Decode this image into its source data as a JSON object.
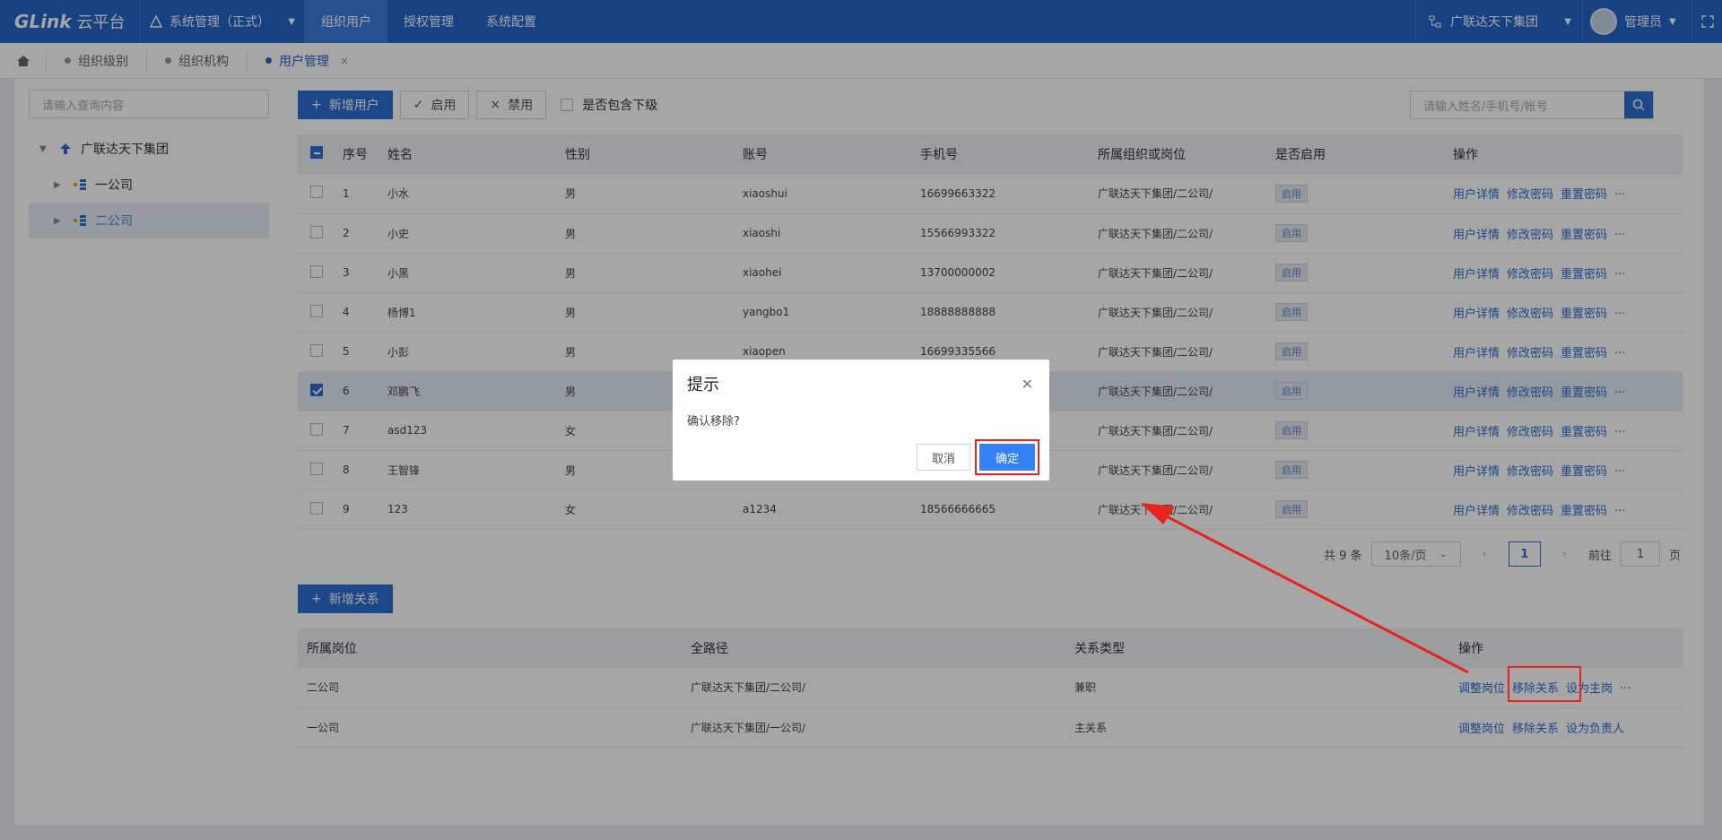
{
  "header": {
    "logo": "GLink",
    "logo_sub": "云平台",
    "system": "系统管理（正式）",
    "nav": [
      "组织用户",
      "授权管理",
      "系统配置"
    ],
    "org": "广联达天下集团",
    "user": "管理员"
  },
  "tabs": [
    "组织级别",
    "组织机构",
    "用户管理"
  ],
  "left": {
    "search_placeholder": "请输入查询内容",
    "tree": [
      "广联达天下集团",
      "一公司",
      "二公司"
    ]
  },
  "toolbar": {
    "add_user": "新增用户",
    "enable": "启用",
    "disable": "禁用",
    "include_sub": "是否包含下级",
    "search_placeholder": "请输入姓名/手机号/帐号"
  },
  "users": {
    "columns": [
      "序号",
      "姓名",
      "性别",
      "账号",
      "手机号",
      "所属组织或岗位",
      "是否启用",
      "操作"
    ],
    "rows": [
      {
        "no": "1",
        "name": "小水",
        "gender": "男",
        "account": "xiaoshui",
        "phone": "16699663322",
        "org": "广联达天下集团/二公司/",
        "status": "启用"
      },
      {
        "no": "2",
        "name": "小史",
        "gender": "男",
        "account": "xiaoshi",
        "phone": "15566993322",
        "org": "广联达天下集团/二公司/",
        "status": "启用"
      },
      {
        "no": "3",
        "name": "小黑",
        "gender": "男",
        "account": "xiaohei",
        "phone": "13700000002",
        "org": "广联达天下集团/二公司/",
        "status": "启用"
      },
      {
        "no": "4",
        "name": "杨博1",
        "gender": "男",
        "account": "yangbo1",
        "phone": "18888888888",
        "org": "广联达天下集团/二公司/",
        "status": "启用"
      },
      {
        "no": "5",
        "name": "小彭",
        "gender": "男",
        "account": "xiaopen",
        "phone": "16699335566",
        "org": "广联达天下集团/二公司/",
        "status": "启用"
      },
      {
        "no": "6",
        "name": "邓鹏飞",
        "gender": "男",
        "account": "",
        "phone": "",
        "org": "广联达天下集团/二公司/",
        "status": "启用"
      },
      {
        "no": "7",
        "name": "asd123",
        "gender": "女",
        "account": "",
        "phone": "",
        "org": "广联达天下集团/二公司/",
        "status": "启用"
      },
      {
        "no": "8",
        "name": "王智锋",
        "gender": "男",
        "account": "",
        "phone": "",
        "org": "广联达天下集团/二公司/",
        "status": "启用"
      },
      {
        "no": "9",
        "name": "123",
        "gender": "女",
        "account": "a1234",
        "phone": "18566666665",
        "org": "广联达天下集团/二公司/",
        "status": "启用"
      }
    ],
    "ops": [
      "用户详情",
      "修改密码",
      "重置密码",
      "···"
    ]
  },
  "pager": {
    "total": "共 9 条",
    "size": "10条/页",
    "page": "1",
    "goto": "前往",
    "goto_val": "1",
    "unit": "页"
  },
  "relations": {
    "add": "新增关系",
    "columns": [
      "所属岗位",
      "全路径",
      "关系类型",
      "操作"
    ],
    "rows": [
      {
        "post": "二公司",
        "path": "广联达天下集团/二公司/",
        "type": "兼职",
        "ops": [
          "调整岗位",
          "移除关系",
          "设为主岗",
          "···"
        ]
      },
      {
        "post": "一公司",
        "path": "广联达天下集团/一公司/",
        "type": "主关系",
        "ops": [
          "调整岗位",
          "移除关系",
          "设为负责人"
        ]
      }
    ]
  },
  "dialog": {
    "title": "提示",
    "message": "确认移除?",
    "cancel": "取消",
    "ok": "确定"
  },
  "colors": {
    "primary": "#2364c8",
    "annotation": "#e8231f"
  }
}
